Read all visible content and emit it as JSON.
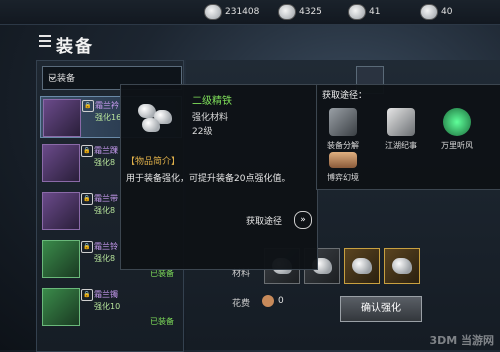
{
  "currencies": [
    {
      "icon": "silver-coin-icon",
      "value": "231408"
    },
    {
      "icon": "feather-icon",
      "value": "4325"
    },
    {
      "icon": "crystal-icon",
      "value": "41"
    },
    {
      "icon": "ticket-icon",
      "value": "40"
    }
  ],
  "page_title": "装备",
  "filter": {
    "selected": "已装备"
  },
  "equipment": [
    {
      "name": "霜兰衿",
      "level": "强化16",
      "selected": true
    },
    {
      "name": "霜兰踝",
      "level": "强化8",
      "selected": false
    },
    {
      "name": "霜兰带",
      "level": "强化8",
      "selected": false
    },
    {
      "name": "霜兰铃",
      "level": "强化8",
      "selected": false
    },
    {
      "name": "霜兰镯",
      "level": "强化10",
      "selected": false
    }
  ],
  "tooltip": {
    "name": "二级精铁",
    "type": "强化材料",
    "level": "22级",
    "section_title": "【物品简介】",
    "description": "用于装备强化，可提升装备20点强化值。",
    "source_label": "获取途径"
  },
  "sources": {
    "title": "获取途径：",
    "items": [
      {
        "label": "装备分解",
        "icon": "sword-icon",
        "color": "#9aa0a6"
      },
      {
        "label": "江湖纪事",
        "icon": "robe-icon",
        "color": "#c8ccd2"
      },
      {
        "label": "万里听风",
        "icon": "jade-orb-icon",
        "color": "#3fcf7a"
      },
      {
        "label": "博弈幻境",
        "icon": "bowl-icon",
        "color": "#d89a6a"
      }
    ]
  },
  "enhance": {
    "equipped_label": "已装备",
    "equipped_label_2": "已装备",
    "materials_label": "材料",
    "cost_label": "花费",
    "cost_value": "0",
    "confirm_label": "确认强化"
  },
  "watermark": "3DM 当游网"
}
